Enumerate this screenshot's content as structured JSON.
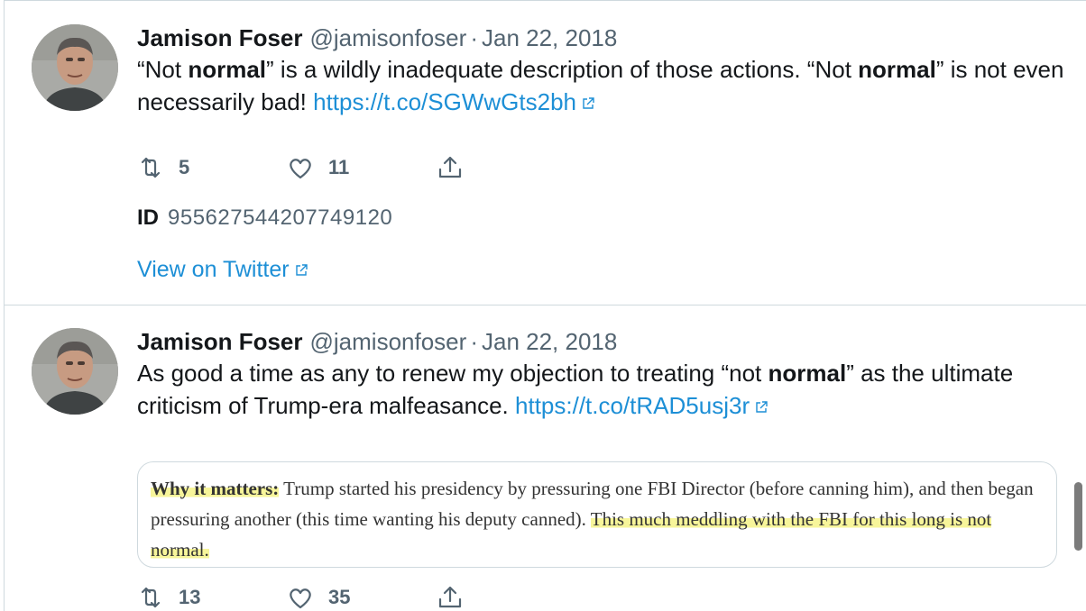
{
  "tweets": [
    {
      "author_name": "Jamison Foser",
      "handle": "@jamisonfoser",
      "separator": "·",
      "date": "Jan 22, 2018",
      "text": {
        "p1": "“Not ",
        "b1": "normal",
        "p2": "” is a wildly inadequate description of those actions. “Not ",
        "b2": "normal",
        "p3": "” is not even necessarily bad! ",
        "link": "https://t.co/SGWwGts2bh"
      },
      "retweets": "5",
      "likes": "11",
      "id_label": "ID",
      "id_value": "955627544207749120",
      "view_on": "View on Twitter"
    },
    {
      "author_name": "Jamison Foser",
      "handle": "@jamisonfoser",
      "separator": "·",
      "date": "Jan 22, 2018",
      "text": {
        "p1": "As good a time as any to renew my objection to treating “not ",
        "b1": "normal",
        "p2": "” as the ultimate criticism of Trump-era malfeasance. ",
        "link": "https://t.co/tRAD5usj3r"
      },
      "quote": {
        "lead": "Why it matters:",
        "body": " Trump started his presidency by pressuring one FBI Director (before canning him), and then began pressuring another (this time wanting his deputy canned). ",
        "highlight": "This much meddling with the FBI for this long is not normal."
      },
      "retweets": "13",
      "likes": "35"
    }
  ],
  "icons": {
    "avatar": "avatar-photo",
    "external": "external-link-icon",
    "retweet": "retweet-icon",
    "like": "heart-icon",
    "share": "share-icon"
  },
  "colors": {
    "link": "#1d8fd6",
    "muted": "#536471",
    "highlight": "#f7f59a",
    "border": "#cfd9de"
  }
}
